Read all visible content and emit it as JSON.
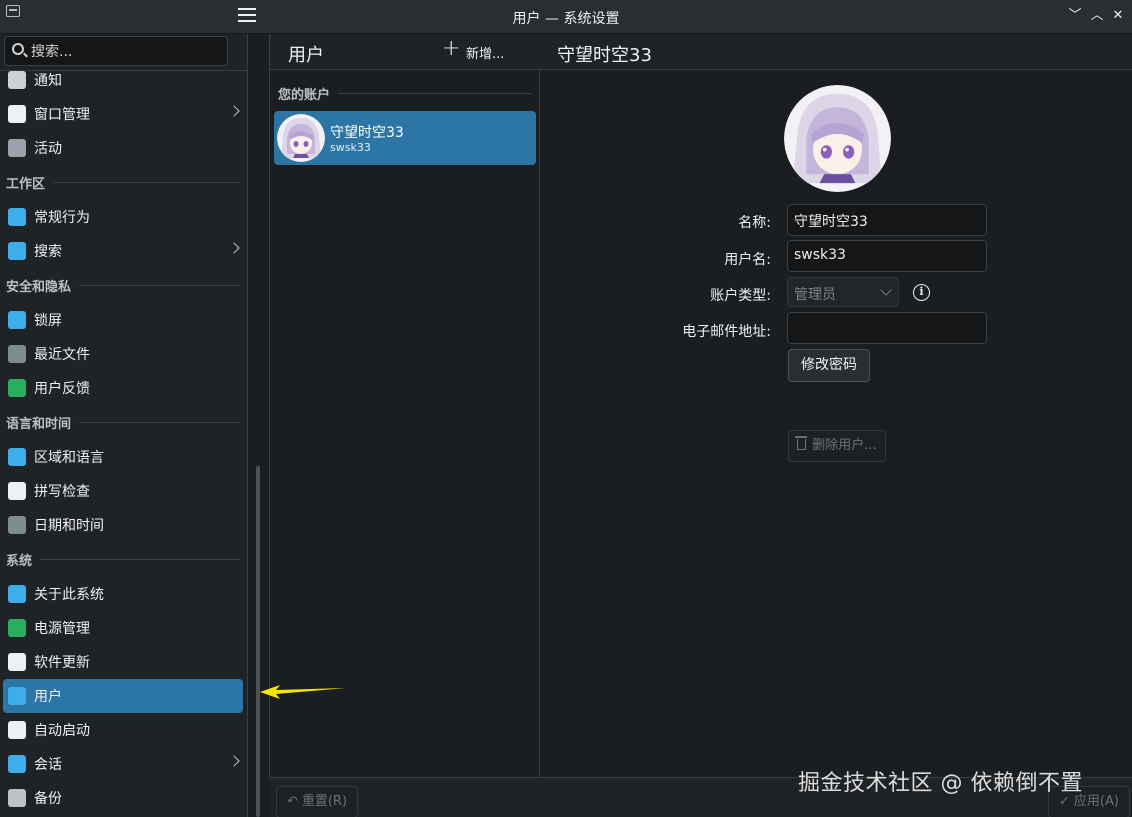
{
  "window": {
    "title": "用户 — 系统设置",
    "buttons": [
      "﹀",
      "︿",
      "✕"
    ]
  },
  "sidebar": {
    "search_placeholder": "搜索...",
    "items": [
      {
        "type": "item",
        "label": "通知",
        "icon": "bell-icon",
        "color": "#cfd2d4"
      },
      {
        "type": "item",
        "label": "窗口管理",
        "icon": "window-icon",
        "color": "#eff0f1",
        "chevron": true
      },
      {
        "type": "item",
        "label": "活动",
        "icon": "activities-icon",
        "color": "#9aa3ab"
      },
      {
        "type": "section",
        "label": "工作区"
      },
      {
        "type": "item",
        "label": "常规行为",
        "icon": "general-behavior-icon",
        "color": "#3daee9"
      },
      {
        "type": "item",
        "label": "搜索",
        "icon": "search-icon",
        "color": "#3daee9",
        "chevron": true
      },
      {
        "type": "section",
        "label": "安全和隐私"
      },
      {
        "type": "item",
        "label": "锁屏",
        "icon": "lock-screen-icon",
        "color": "#3daee9"
      },
      {
        "type": "item",
        "label": "最近文件",
        "icon": "clock-icon",
        "color": "#7f8c8d"
      },
      {
        "type": "item",
        "label": "用户反馈",
        "icon": "feedback-icon",
        "color": "#27ae60"
      },
      {
        "type": "section",
        "label": "语言和时间"
      },
      {
        "type": "item",
        "label": "区域和语言",
        "icon": "region-icon",
        "color": "#3daee9"
      },
      {
        "type": "item",
        "label": "拼写检查",
        "icon": "spellcheck-icon",
        "color": "#eff0f1"
      },
      {
        "type": "item",
        "label": "日期和时间",
        "icon": "clock-icon",
        "color": "#7f8c8d"
      },
      {
        "type": "section",
        "label": "系统"
      },
      {
        "type": "item",
        "label": "关于此系统",
        "icon": "info-icon",
        "color": "#3daee9"
      },
      {
        "type": "item",
        "label": "电源管理",
        "icon": "power-icon",
        "color": "#27ae60"
      },
      {
        "type": "item",
        "label": "软件更新",
        "icon": "update-icon",
        "color": "#eff0f1"
      },
      {
        "type": "item",
        "label": "用户",
        "icon": "users-icon",
        "color": "#3daee9",
        "active": true
      },
      {
        "type": "item",
        "label": "自动启动",
        "icon": "autostart-icon",
        "color": "#eff0f1"
      },
      {
        "type": "item",
        "label": "会话",
        "icon": "session-icon",
        "color": "#3daee9",
        "chevron": true
      },
      {
        "type": "item",
        "label": "备份",
        "icon": "backup-icon",
        "color": "#bdc3c7"
      }
    ]
  },
  "users_list": {
    "title": "用户",
    "add_label": "新增...",
    "section_label": "您的账户",
    "accounts": [
      {
        "name": "守望时空33",
        "username": "swsk33"
      }
    ]
  },
  "user_detail": {
    "title": "守望时空33",
    "name_label": "名称:",
    "name_value": "守望时空33",
    "username_label": "用户名:",
    "username_value": "swsk33",
    "account_type_label": "账户类型:",
    "account_type_value": "管理员",
    "email_label": "电子邮件地址:",
    "email_value": "",
    "change_password_label": "修改密码",
    "delete_user_label": "删除用户..."
  },
  "footer": {
    "reset_label": "重置(R)",
    "apply_label": "应用(A)"
  },
  "watermark": "掘金技术社区 @ 依赖倒不置",
  "colors": {
    "accent": "#2c76a6",
    "background": "#1b1e20",
    "annotation_arrow": "#f5e600"
  }
}
